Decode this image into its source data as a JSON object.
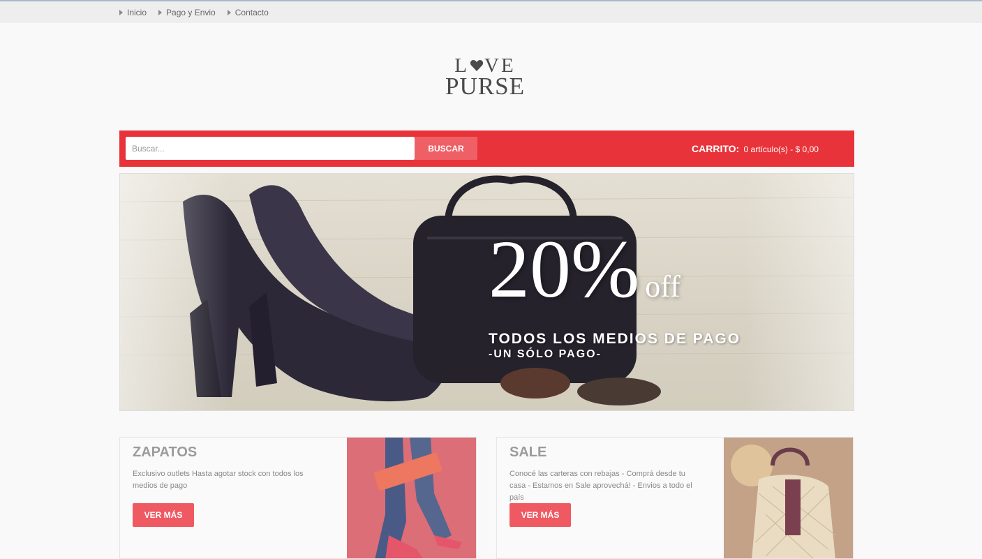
{
  "nav": {
    "items": [
      "Inicio",
      "Pago y Envio",
      "Contacto"
    ]
  },
  "logo": {
    "line1_left": "L",
    "line1_right": "VE",
    "line2": "PURSE"
  },
  "search": {
    "placeholder": "Buscar...",
    "button_label": "BUSCAR"
  },
  "cart": {
    "label": "CARRITO:",
    "summary": "0 artículo(s) - $ 0,00"
  },
  "hero": {
    "big": "20%",
    "off": "off",
    "line1": "TODOS LOS MEDIOS DE PAGO",
    "line2": "-UN SÓLO PAGO-"
  },
  "cards": [
    {
      "title": "ZAPATOS",
      "description": "Exclusivo outlets Hasta agotar stock con todos los medios de pago",
      "button_label": "VER MÁS"
    },
    {
      "title": "SALE",
      "description": "Conocé las carteras con rebajas - Comprá desde tu casa - Estamos en Sale aprovechá! - Envios a todo el país",
      "button_label": "VER MÁS"
    }
  ],
  "colors": {
    "accent_red": "#e8333a",
    "button_red": "#ef5a62",
    "topbar_bg": "#eeeeee"
  }
}
